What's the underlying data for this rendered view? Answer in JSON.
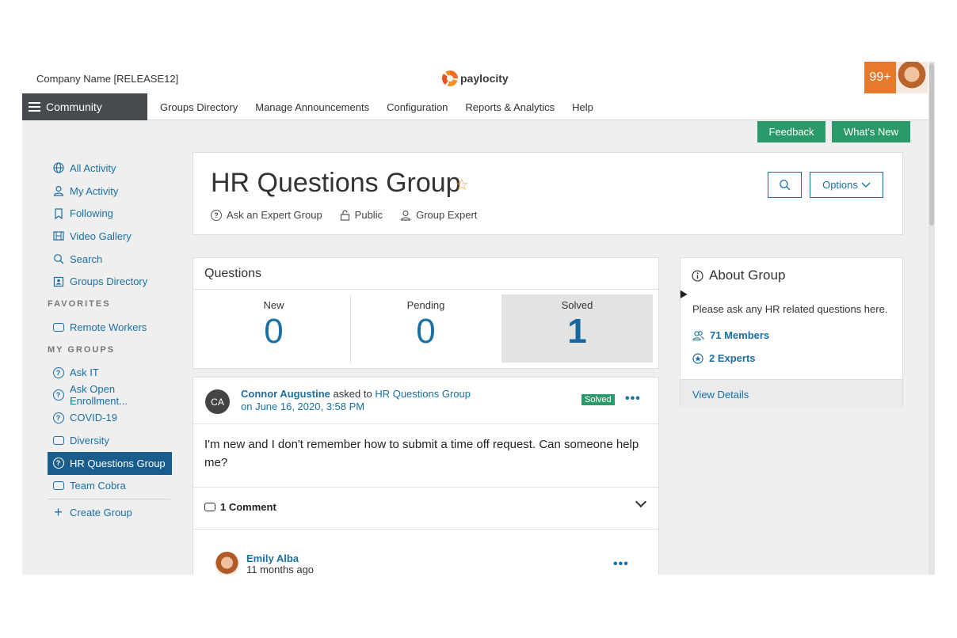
{
  "topbar": {
    "company": "Company Name [RELEASE12]",
    "brand": "paylocity",
    "notifications": "99+"
  },
  "nav": {
    "community": "Community",
    "links": [
      "Groups Directory",
      "Manage Announcements",
      "Configuration",
      "Reports & Analytics",
      "Help"
    ]
  },
  "actions": {
    "feedback": "Feedback",
    "whats_new": "What's New"
  },
  "sidebar": {
    "items": [
      {
        "label": "All Activity",
        "icon": "globe-icon"
      },
      {
        "label": "My Activity",
        "icon": "user-icon"
      },
      {
        "label": "Following",
        "icon": "bookmark-icon"
      },
      {
        "label": "Video Gallery",
        "icon": "film-icon"
      },
      {
        "label": "Search",
        "icon": "search-icon"
      },
      {
        "label": "Groups Directory",
        "icon": "directory-icon"
      }
    ],
    "favorites_heading": "FAVORITES",
    "favorites": [
      {
        "label": "Remote Workers",
        "icon": "chat-icon"
      }
    ],
    "my_groups_heading": "MY GROUPS",
    "my_groups": [
      {
        "label": "Ask IT",
        "icon": "question-icon"
      },
      {
        "label": "Ask Open Enrollment...",
        "icon": "question-icon"
      },
      {
        "label": "COVID-19",
        "icon": "question-icon"
      },
      {
        "label": "Diversity",
        "icon": "chat-icon"
      },
      {
        "label": "HR Questions Group",
        "icon": "question-icon",
        "active": true
      },
      {
        "label": "Team Cobra",
        "icon": "chat-icon"
      }
    ],
    "create_group": "Create Group"
  },
  "group": {
    "title": "HR Questions Group",
    "type": "Ask an Expert Group",
    "visibility": "Public",
    "role": "Group Expert",
    "options_label": "Options"
  },
  "questions": {
    "title": "Questions",
    "stats": [
      {
        "label": "New",
        "value": "0"
      },
      {
        "label": "Pending",
        "value": "0"
      },
      {
        "label": "Solved",
        "value": "1"
      }
    ]
  },
  "post": {
    "avatar_initials": "CA",
    "author": "Connor Augustine",
    "action": "asked to",
    "group": "HR Questions Group",
    "date": "on June 16, 2020, 3:58 PM",
    "status": "Solved",
    "body": "I'm new and I don't remember how to submit a time off request. Can someone help me?",
    "comments": "1 Comment",
    "comment_author": "Emily Alba",
    "comment_time": "11 months ago"
  },
  "about": {
    "title": "About Group",
    "description": "Please ask any HR related questions here.",
    "members": "71 Members",
    "experts": "2 Experts",
    "view_details": "View Details"
  },
  "colors": {
    "accent": "#1a6fa3",
    "green": "#2b9a6a",
    "nav_dark": "#474b50",
    "notification": "#e8782a"
  }
}
